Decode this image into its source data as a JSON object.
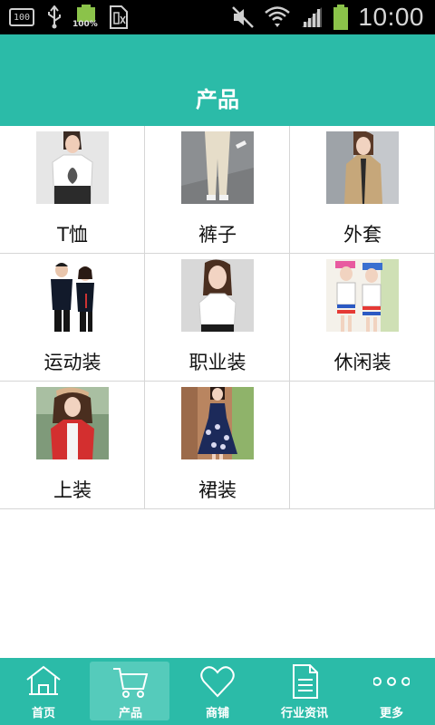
{
  "status_bar": {
    "box_icon_text": "100",
    "battery_small_percent": "100%",
    "time": "10:00"
  },
  "header": {
    "title": "产品"
  },
  "products": [
    {
      "label": "T恤",
      "icon": "tshirt-photo"
    },
    {
      "label": "裤子",
      "icon": "pants-photo"
    },
    {
      "label": "外套",
      "icon": "coat-photo"
    },
    {
      "label": "运动装",
      "icon": "sportswear-photo"
    },
    {
      "label": "职业装",
      "icon": "workwear-photo"
    },
    {
      "label": "休闲装",
      "icon": "casualwear-photo"
    },
    {
      "label": "上装",
      "icon": "tops-photo"
    },
    {
      "label": "裙装",
      "icon": "dress-photo"
    }
  ],
  "bottom_nav": [
    {
      "label": "首页",
      "icon": "home-icon"
    },
    {
      "label": "产品",
      "icon": "cart-icon",
      "active": true
    },
    {
      "label": "商铺",
      "icon": "heart-icon"
    },
    {
      "label": "行业资讯",
      "icon": "document-icon"
    },
    {
      "label": "更多",
      "icon": "more-icon"
    }
  ],
  "colors": {
    "accent": "#2bbba8",
    "active_nav": "#55cbbb",
    "status_bar": "#000000",
    "divider": "#d6d6d6"
  }
}
